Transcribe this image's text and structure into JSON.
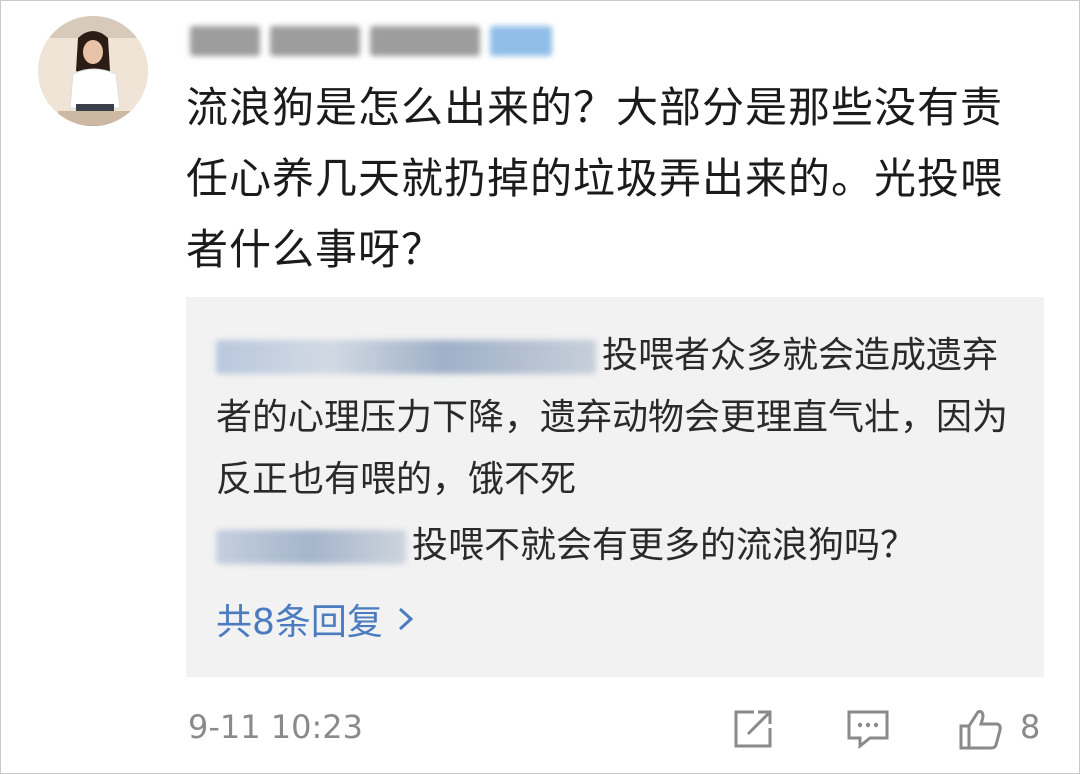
{
  "comment": {
    "text": "流浪狗是怎么出来的？大部分是那些没有责任心养几天就扔掉的垃圾弄出来的。光投喂者什么事呀？",
    "time": "9-11 10:23",
    "like_count": "8"
  },
  "replies": [
    {
      "text": "投喂者众多就会造成遗弃者的心理压力下降，遗弃动物会更理直气壮，因为反正也有喂的，饿不死"
    },
    {
      "text": "投喂不就会有更多的流浪狗吗？"
    }
  ],
  "more_replies_label": "共8条回复",
  "icons": {
    "more": "chevron-right-icon",
    "share": "share-icon",
    "reply": "comment-icon",
    "like": "thumbs-up-icon"
  },
  "colors": {
    "link": "#4b7cc0",
    "reply_bg": "#f2f2f2",
    "meta": "#8a8a8a"
  }
}
